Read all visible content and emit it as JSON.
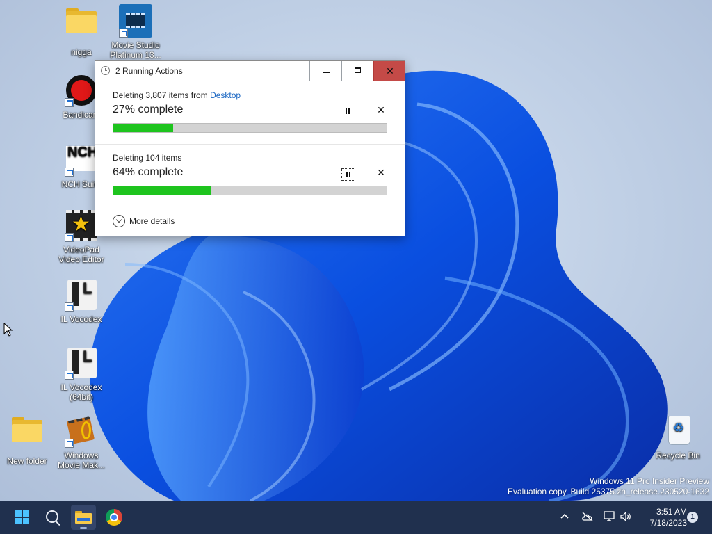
{
  "desktop": {
    "icons": [
      {
        "label": "nigga"
      },
      {
        "label": "Movie Studio Platinum 13..."
      },
      {
        "label": "Bandicam"
      },
      {
        "label": "NCH Suite"
      },
      {
        "label": "VideoPad Video Editor"
      },
      {
        "label": "IL Vocodex"
      },
      {
        "label": "IL Vocodex (64bit)"
      },
      {
        "label": "New folder"
      },
      {
        "label": "Windows Movie Mak..."
      },
      {
        "label": "Recycle Bin"
      }
    ],
    "watermark": {
      "line1": "Windows 11 Pro Insider Preview",
      "line2": "Evaluation copy. Build 25375.zn_release.230520-1632"
    }
  },
  "dialog": {
    "title": "2 Running Actions",
    "actions": [
      {
        "desc_prefix": "Deleting 3,807 items from ",
        "desc_link": "Desktop",
        "percent_label": "27% complete",
        "progress_fraction": 0.22
      },
      {
        "desc_prefix": "Deleting 104 items",
        "desc_link": "",
        "percent_label": "64% complete",
        "progress_fraction": 0.36
      }
    ],
    "more_details": "More details",
    "controls": {
      "minimize_icon": "minimize-icon",
      "maximize_icon": "maximize-icon",
      "close_icon": "close-icon",
      "close_glyph": "✕",
      "cancel_glyph": "✕"
    }
  },
  "taskbar": {
    "clock": {
      "time": "3:51 AM",
      "date": "7/18/2023"
    },
    "notification_count": "1",
    "icons": [
      "start-icon",
      "search-icon",
      "file-explorer-icon",
      "chrome-icon"
    ],
    "tray_icons": [
      "chevron-up-icon",
      "onedrive-icon",
      "network-icon",
      "volume-icon"
    ]
  },
  "colors": {
    "progress_fill": "#1ec41e",
    "close_button": "#c44a47",
    "link": "#1a66c2",
    "taskbar": "#20304e"
  }
}
